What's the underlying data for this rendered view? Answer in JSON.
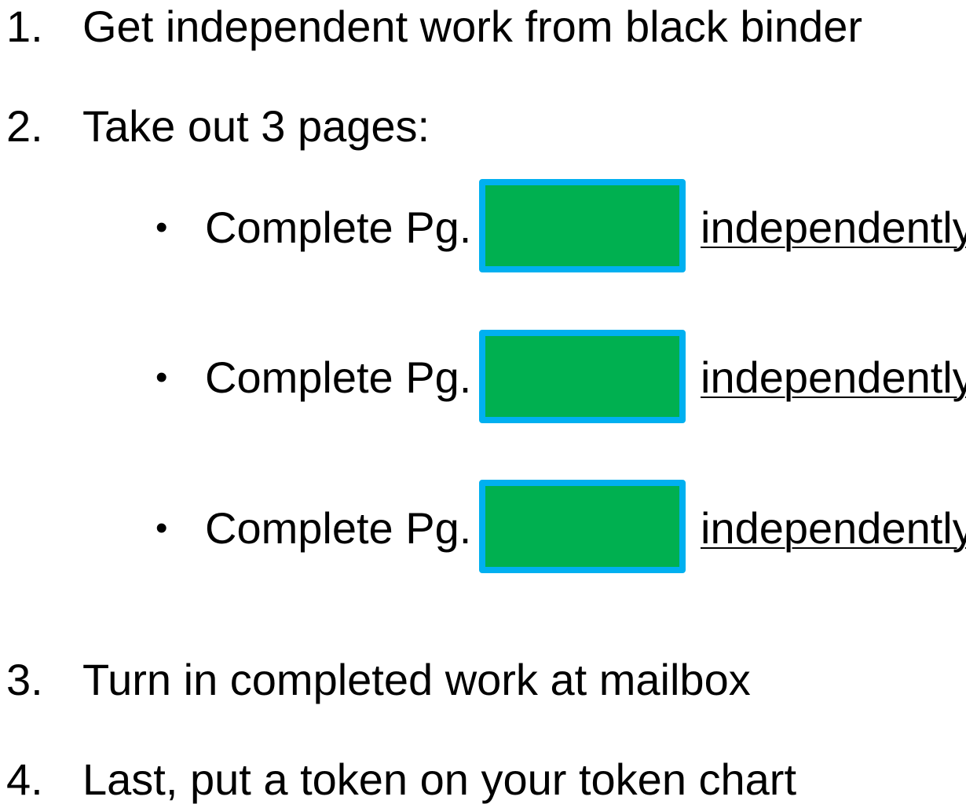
{
  "steps": [
    {
      "number": "1.",
      "text": "Get independent work from black binder"
    },
    {
      "number": "2.",
      "text": "Take out 3 pages:"
    },
    {
      "number": "3.",
      "text": "Turn in completed work at mailbox"
    },
    {
      "number": "4.",
      "text": "Last, put a token on your token chart"
    }
  ],
  "subitems": [
    {
      "bullet": "•",
      "label": "Complete Pg.",
      "suffix": "independently"
    },
    {
      "bullet": "•",
      "label": "Complete Pg.",
      "suffix": "independently"
    },
    {
      "bullet": "•",
      "label": "Complete Pg.",
      "suffix": "independently"
    }
  ],
  "colors": {
    "box_fill": "#00b050",
    "box_border": "#00b0f0",
    "text": "#000000"
  }
}
